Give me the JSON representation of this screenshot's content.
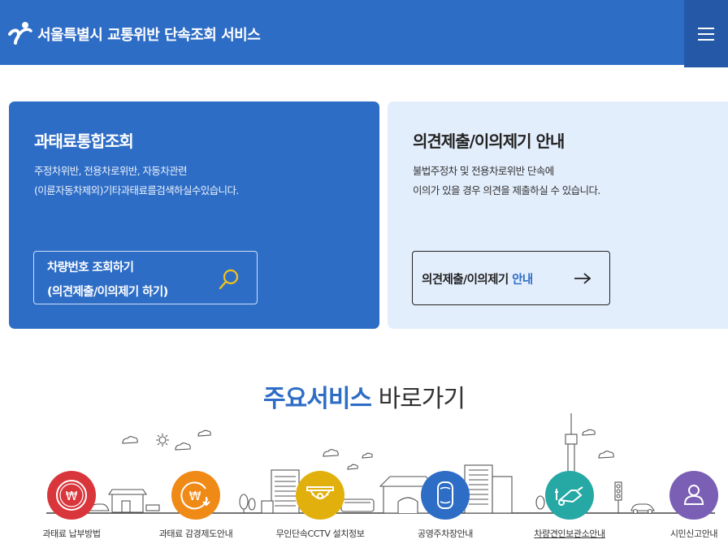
{
  "header": {
    "title": "서울특별시 교통위반 단속조회 서비스",
    "menu_icon": "hamburger-icon"
  },
  "colors": {
    "primary": "#2e6dc6",
    "menu_bg": "#2559a8",
    "light_card": "#e3eefc"
  },
  "card_left": {
    "title": "과태료통합조회",
    "desc_line1": "주정차위반, 전용차로위반, 자동차관련",
    "desc_line2": "(이륜자동차제외)기타과태료를검색하실수있습니다.",
    "button_line1": "차량번호 조회하기",
    "button_line2": "(의견제출/이의제기 하기)",
    "button_icon": "search-icon"
  },
  "card_right": {
    "title": "의견제출/이의제기 안내",
    "desc_line1": "불법주정차 및 전용차로위반 단속에",
    "desc_line2": "이의가 있을 경우 의견을 제출하실 수 있습니다.",
    "button_label": "의견제출/이의제기",
    "button_accent": "안내",
    "button_icon": "arrow-right-icon"
  },
  "section": {
    "title_strong": "주요서비스",
    "title_light": "바로가기"
  },
  "services": [
    {
      "label": "과태료 납부방법",
      "icon": "won-coin-icon",
      "color": "#d9363c"
    },
    {
      "label": "과태료 감경제도안내",
      "icon": "won-discount-icon",
      "color": "#f08a16"
    },
    {
      "label": "무인단속CCTV 설치정보",
      "icon": "cctv-icon",
      "color": "#e2b00d"
    },
    {
      "label": "공영주차장안내",
      "icon": "car-top-icon",
      "color": "#2e6dc6"
    },
    {
      "label": "차량견인보관소안내",
      "icon": "tow-car-icon",
      "color": "#26a8a5"
    },
    {
      "label": "시민신고안내",
      "icon": "person-icon",
      "color": "#7a5fb5"
    }
  ]
}
